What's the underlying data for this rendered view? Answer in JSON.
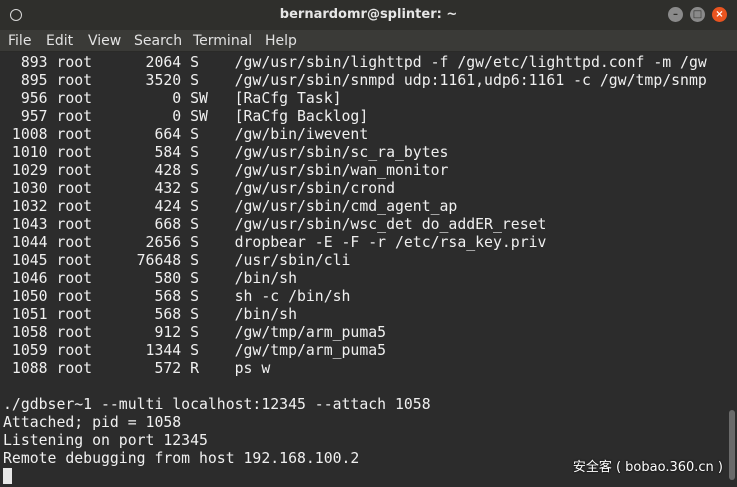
{
  "window": {
    "title": "bernardomr@splinter: ~",
    "menu_icon": "circle-icon",
    "minimize_icon": "minimize-icon",
    "maximize_icon": "maximize-icon",
    "close_icon": "close-icon"
  },
  "menu": {
    "file": "File",
    "edit": "Edit",
    "view": "View",
    "search": "Search",
    "terminal": "Terminal",
    "help": "Help"
  },
  "terminal": {
    "lines": [
      "  893 root      2064 S    /gw/usr/sbin/lighttpd -f /gw/etc/lighttpd.conf -m /gw",
      "  895 root      3520 S    /gw/usr/sbin/snmpd udp:1161,udp6:1161 -c /gw/tmp/snmp",
      "  956 root         0 SW   [RaCfg Task]",
      "  957 root         0 SW   [RaCfg Backlog]",
      " 1008 root       664 S    /gw/bin/iwevent",
      " 1010 root       584 S    /gw/usr/sbin/sc_ra_bytes",
      " 1029 root       428 S    /gw/usr/sbin/wan_monitor",
      " 1030 root       432 S    /gw/usr/sbin/crond",
      " 1032 root       424 S    /gw/usr/sbin/cmd_agent_ap",
      " 1043 root       668 S    /gw/usr/sbin/wsc_det do_addER_reset",
      " 1044 root      2656 S    dropbear -E -F -r /etc/rsa_key.priv",
      " 1045 root     76648 S    /usr/sbin/cli",
      " 1046 root       580 S    /bin/sh",
      " 1050 root       568 S    sh -c /bin/sh",
      " 1051 root       568 S    /bin/sh",
      " 1058 root       912 S    /gw/tmp/arm_puma5",
      " 1059 root      1344 S    /gw/tmp/arm_puma5",
      " 1088 root       572 R    ps w",
      "",
      "./gdbser~1 --multi localhost:12345 --attach 1058",
      "Attached; pid = 1058",
      "Listening on port 12345",
      "Remote debugging from host 192.168.100.2"
    ]
  },
  "watermark": "安全客 ( bobao.360.cn )"
}
